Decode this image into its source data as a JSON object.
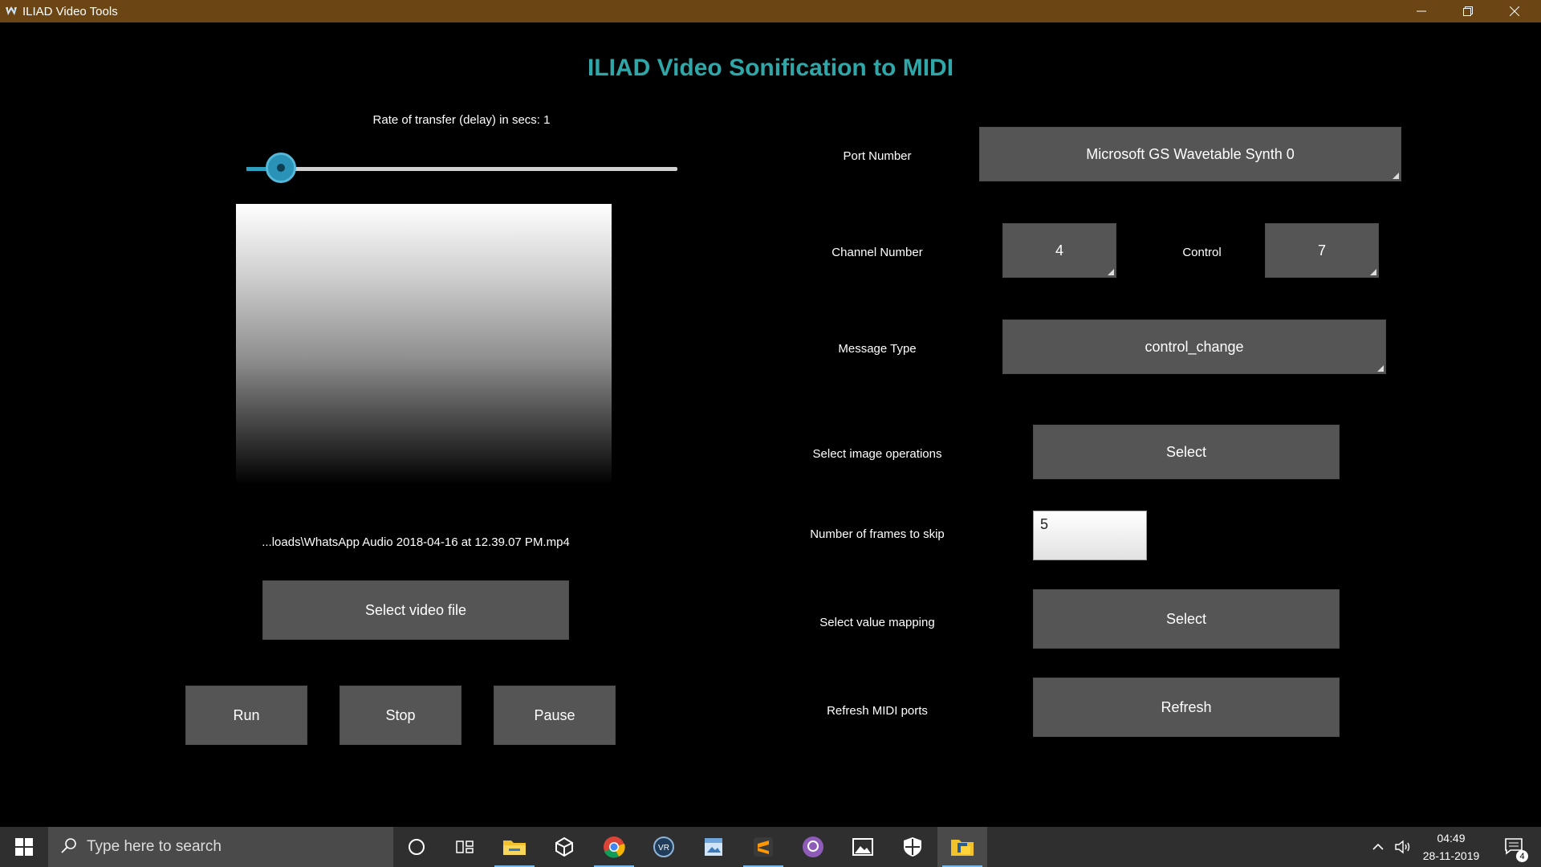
{
  "window": {
    "title": "ILIAD Video Tools",
    "minimize_icon": "minimize-icon",
    "restore_icon": "restore-icon",
    "close_icon": "close-icon"
  },
  "app": {
    "heading": "ILIAD Video Sonification to MIDI",
    "accent_color": "#2fa7a8"
  },
  "left_panel": {
    "rate_label": "Rate of transfer (delay) in secs: 1",
    "delay_slider_fraction": 0.08,
    "file_path": "...loads\\WhatsApp Audio 2018-04-16 at 12.39.07 PM.mp4",
    "select_video_label": "Select video file",
    "run_label": "Run",
    "stop_label": "Stop",
    "pause_label": "Pause"
  },
  "right_panel": {
    "port_label": "Port Number",
    "port_value": "Microsoft GS Wavetable Synth 0",
    "channel_label": "Channel Number",
    "channel_value": "4",
    "control_label": "Control",
    "control_value": "7",
    "message_type_label": "Message Type",
    "message_type_value": "control_change",
    "image_ops_label": "Select image operations",
    "image_ops_button": "Select",
    "frames_skip_label": "Number of frames to skip",
    "frames_skip_value": "5",
    "value_mapping_label": "Select value mapping",
    "value_mapping_button": "Select",
    "refresh_label": "Refresh MIDI ports",
    "refresh_button": "Refresh"
  },
  "taskbar": {
    "search_placeholder": "Type here to search",
    "time": "04:49",
    "date": "28-11-2019",
    "notification_count": "4",
    "apps": [
      "cortana-icon",
      "task-view-icon",
      "file-explorer-icon",
      "unity-icon",
      "chrome-icon",
      "vr-icon",
      "image-viewer-icon",
      "sublime-text-icon",
      "github-icon",
      "photos-icon",
      "security-icon",
      "python-app-icon"
    ]
  }
}
